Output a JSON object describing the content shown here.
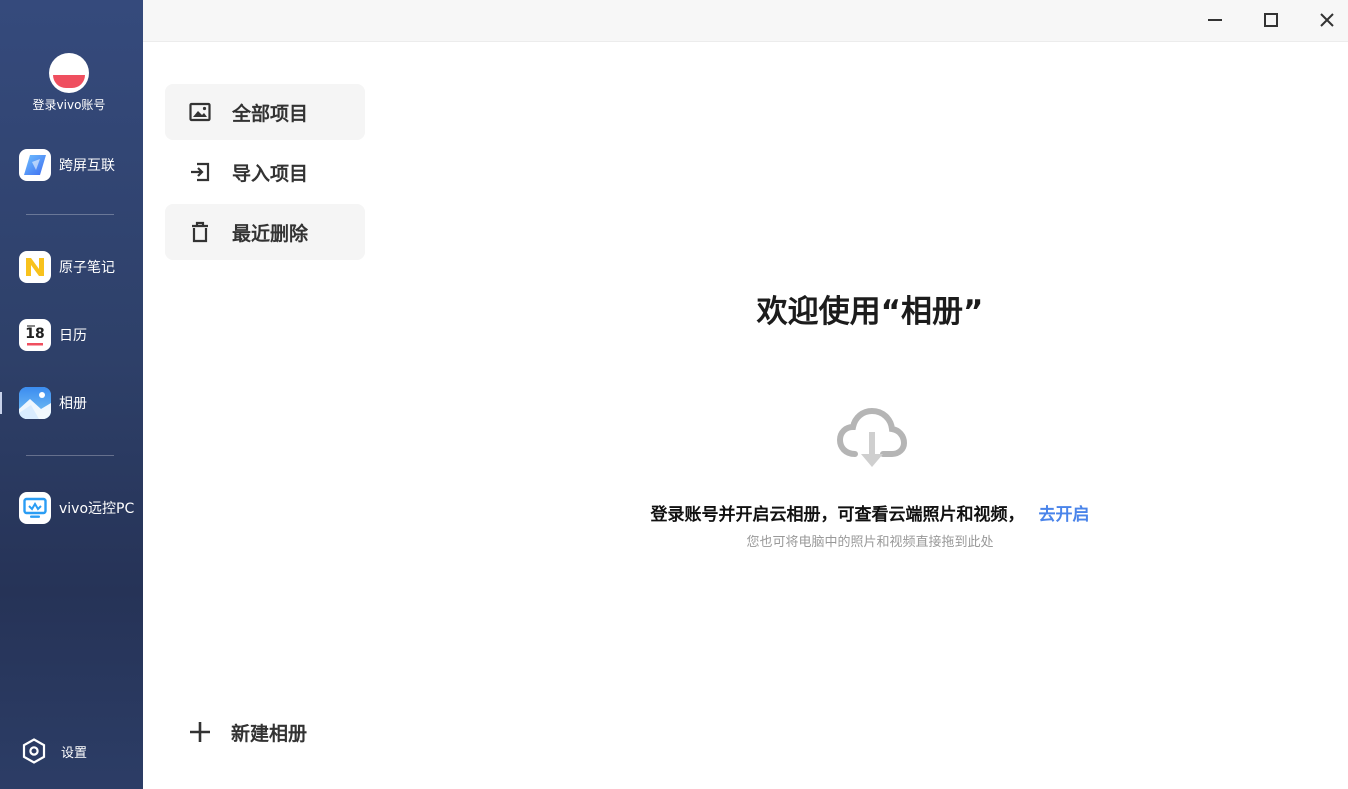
{
  "sidebar": {
    "account_label": "登录vivo账号",
    "items": [
      {
        "label": "跨屏互联",
        "icon": "cross-screen-icon"
      },
      {
        "label": "原子笔记",
        "icon": "atom-notes-icon"
      },
      {
        "label": "日历",
        "icon": "calendar-icon",
        "day": "18"
      },
      {
        "label": "相册",
        "icon": "album-icon",
        "active": true
      },
      {
        "label": "vivo远控PC",
        "icon": "remote-pc-icon"
      }
    ],
    "settings_label": "设置"
  },
  "window_controls": [
    "minimize-icon",
    "maximize-icon",
    "close-icon"
  ],
  "nav": {
    "items": [
      {
        "label": "全部项目",
        "icon": "image-icon",
        "active": true
      },
      {
        "label": "导入项目",
        "icon": "import-icon"
      },
      {
        "label": "最近删除",
        "icon": "trash-icon"
      }
    ],
    "new_album_label": "新建相册"
  },
  "main": {
    "welcome_title": "欢迎使用“相册”",
    "hint_text": "登录账号并开启云相册，可查看云端照片和视频，",
    "hint_link": "去开启",
    "sub_hint": "您也可将电脑中的照片和视频直接拖到此处"
  },
  "colors": {
    "sidebar_bg": "#2e4069",
    "accent": "#456fe8",
    "link": "#4a84ea"
  }
}
